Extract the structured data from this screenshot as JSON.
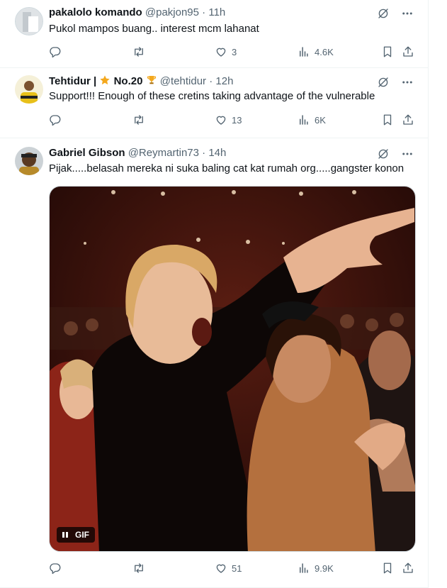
{
  "tweets": [
    {
      "name": "pakalolo komando",
      "handle": "@pakjon95",
      "sep": "·",
      "time": "11h",
      "text": "Pukol mampos buang.. interest mcm lahanat",
      "replies": "",
      "retweets": "",
      "likes": "3",
      "views": "4.6K"
    },
    {
      "name": "Tehtidur |",
      "badge_text": "No.20",
      "handle": "@tehtidur",
      "sep": "·",
      "time": "12h",
      "text": "Support!!! Enough of these cretins taking advantage of the vulnerable",
      "replies": "",
      "retweets": "",
      "likes": "13",
      "views": "6K"
    },
    {
      "name": "Gabriel Gibson",
      "handle": "@Reymartin73",
      "sep": "·",
      "time": "14h",
      "text": "Pijak.....belasah mereka ni suka baling cat kat rumah org.....gangster konon",
      "gif_label": "GIF",
      "replies": "",
      "retweets": "",
      "likes": "51",
      "views": "9.9K"
    }
  ],
  "colors": {
    "text": "#0f1419",
    "muted": "#536471",
    "border": "#eff3f4"
  },
  "icons": [
    "grok-icon",
    "more-icon",
    "reply-icon",
    "retweet-icon",
    "like-icon",
    "views-icon",
    "bookmark-icon",
    "share-icon",
    "star-icon",
    "trophy-icon",
    "pause-icon"
  ]
}
